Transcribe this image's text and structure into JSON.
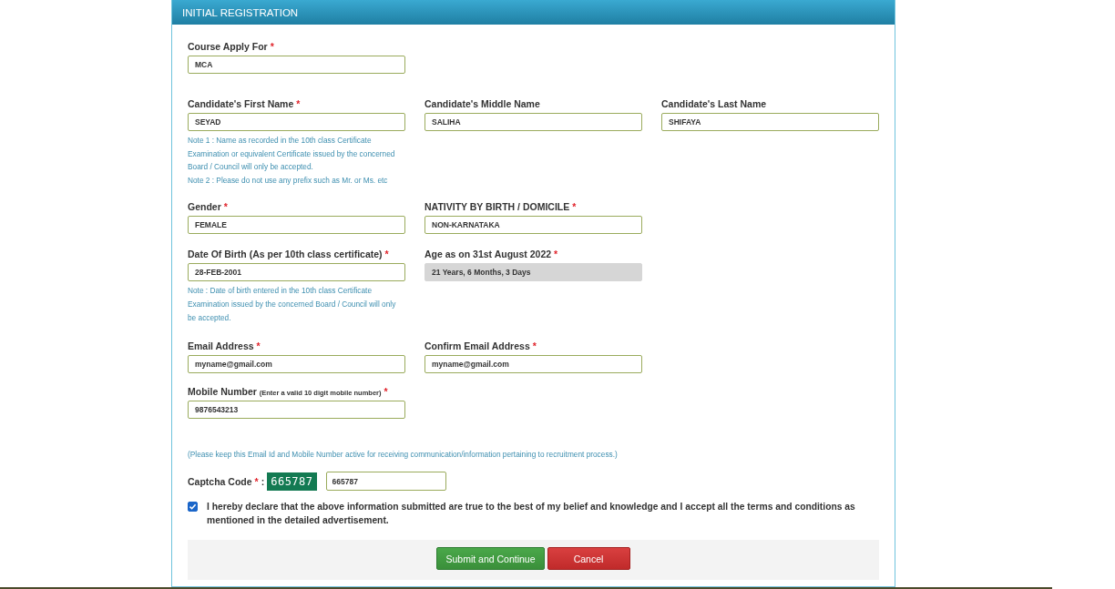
{
  "panel": {
    "title": "INITIAL REGISTRATION"
  },
  "rows": [
    [
      {
        "label": "Course Apply For",
        "required_mark": "*",
        "value": "MCA",
        "disabled": false
      }
    ],
    [
      {
        "label": "Candidate's First Name",
        "required_mark": "*",
        "value": "SEYAD",
        "disabled": false,
        "notes": [
          "Note 1 : Name as recorded in the 10th class Certificate Examination or equivalent Certificate issued by the concerned Board / Council will only be accepted.",
          "Note 2 : Please do not use any prefix such as Mr. or Ms. etc"
        ]
      },
      {
        "label": "Candidate's Middle Name",
        "value": "SALIHA",
        "disabled": false
      },
      {
        "label": "Candidate's Last Name",
        "value": "SHIFAYA",
        "disabled": false
      }
    ],
    [
      {
        "label": "Gender",
        "required_mark": "*",
        "value": "FEMALE",
        "disabled": false
      },
      {
        "label": "NATIVITY BY BIRTH / DOMICILE",
        "required_mark": "*",
        "value": "NON-KARNATAKA",
        "disabled": false
      }
    ],
    [
      {
        "label": "Date Of Birth (As per 10th class certificate)",
        "required_mark": "*",
        "value": "28-FEB-2001",
        "disabled": false,
        "notes": [
          "Note : Date of birth entered in the 10th class Certificate Examination issued by the concerned Board / Council will only be accepted."
        ]
      },
      {
        "label": "Age as on 31st August 2022",
        "required_mark": "*",
        "value": "21 Years, 6 Months, 3 Days",
        "disabled": true
      }
    ],
    [
      {
        "label": "Email Address",
        "required_mark": "*",
        "value": "myname@gmail.com",
        "disabled": false
      },
      {
        "label": "Confirm Email Address",
        "required_mark": "*",
        "value": "myname@gmail.com",
        "disabled": false
      }
    ],
    [
      {
        "label": "Mobile Number",
        "hint": "(Enter a valid 10 digit mobile number)",
        "required_mark": "*",
        "value": "9876543213",
        "disabled": false
      }
    ]
  ],
  "notice": "(Please keep this Email Id and Mobile Number active for receiving communication/information pertaining to recruitment process.)",
  "captcha": {
    "label": "Captcha Code",
    "required_mark": "*",
    "separator": ":",
    "code": "665787",
    "value": "665787"
  },
  "declaration": {
    "checked": true,
    "text": "I hereby declare that the above information submitted are true to the best of my belief and knowledge and I accept all the terms and conditions as mentioned in the detailed advertisement."
  },
  "buttons": [
    {
      "label": "Submit and Continue",
      "kind": "primary"
    },
    {
      "label": "Cancel",
      "kind": "danger"
    }
  ]
}
